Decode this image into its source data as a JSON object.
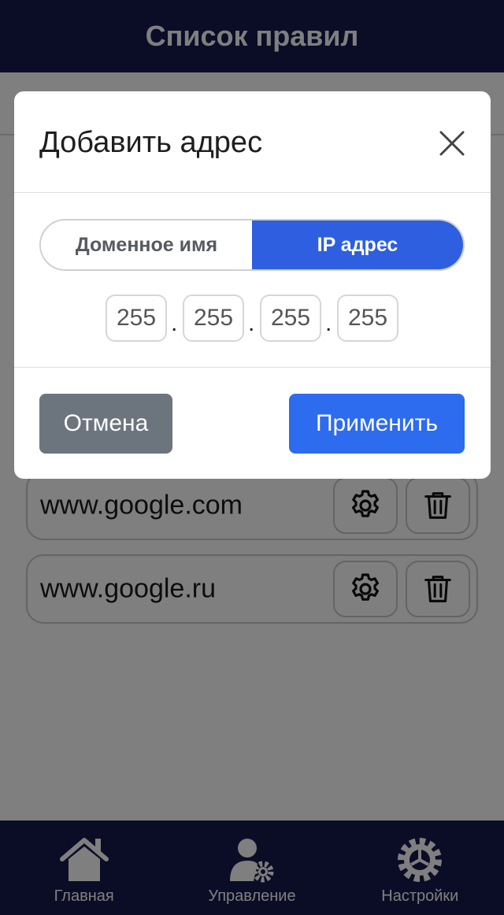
{
  "header": {
    "title": "Список правил"
  },
  "rules": [
    {
      "address": "www.google.com"
    },
    {
      "address": "www.google.ru"
    }
  ],
  "nav": {
    "items": [
      {
        "label": "Главная",
        "icon": "home-icon"
      },
      {
        "label": "Управление",
        "icon": "user-gear-icon"
      },
      {
        "label": "Настройки",
        "icon": "gear-icon"
      }
    ]
  },
  "modal": {
    "title": "Добавить адрес",
    "mode_tabs": {
      "domain": "Доменное имя",
      "ip": "IP адрес",
      "active": "ip"
    },
    "ip_octets": [
      "255",
      "255",
      "255",
      "255"
    ],
    "cancel_label": "Отмена",
    "apply_label": "Применить"
  },
  "colors": {
    "header_bg": "#161a4e",
    "accent": "#2d6bef",
    "cancel_bg": "#6c757d"
  }
}
